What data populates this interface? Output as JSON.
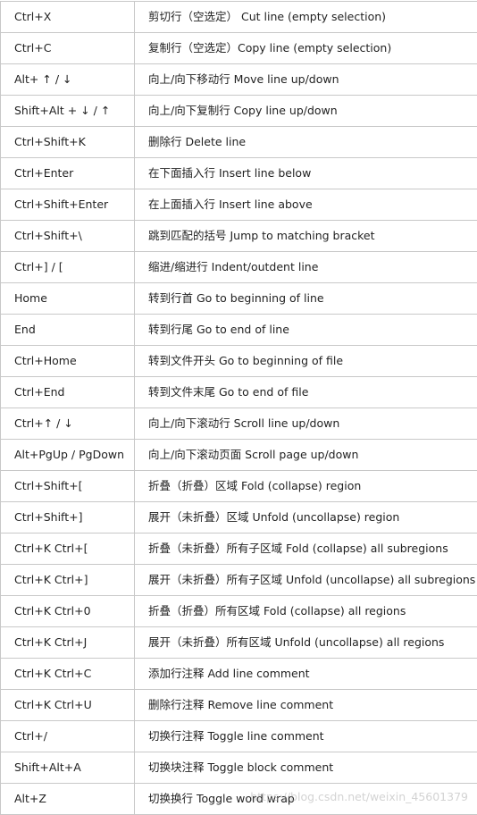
{
  "shortcuts": [
    {
      "key": "Ctrl+X",
      "description": "剪切行（空选定） Cut line (empty selection)"
    },
    {
      "key": "Ctrl+C",
      "description": "复制行（空选定）Copy line (empty selection)"
    },
    {
      "key": "Alt+ ↑ / ↓",
      "description": "向上/向下移动行 Move line up/down"
    },
    {
      "key": "Shift+Alt + ↓ / ↑",
      "description": "向上/向下复制行 Copy line up/down"
    },
    {
      "key": "Ctrl+Shift+K",
      "description": "删除行 Delete line"
    },
    {
      "key": "Ctrl+Enter",
      "description": "在下面插入行 Insert line below"
    },
    {
      "key": "Ctrl+Shift+Enter",
      "description": "在上面插入行 Insert line above"
    },
    {
      "key": "Ctrl+Shift+\\",
      "description": "跳到匹配的括号 Jump to matching bracket"
    },
    {
      "key": "Ctrl+] / [",
      "description": "缩进/缩进行 Indent/outdent line"
    },
    {
      "key": "Home",
      "description": "转到行首 Go to beginning of line"
    },
    {
      "key": "End",
      "description": "转到行尾 Go to end of line"
    },
    {
      "key": "Ctrl+Home",
      "description": "转到文件开头 Go to beginning of file"
    },
    {
      "key": "Ctrl+End",
      "description": "转到文件末尾 Go to end of file"
    },
    {
      "key": "Ctrl+↑ / ↓",
      "description": "向上/向下滚动行 Scroll line up/down"
    },
    {
      "key": "Alt+PgUp / PgDown",
      "description": "向上/向下滚动页面 Scroll page up/down"
    },
    {
      "key": "Ctrl+Shift+[",
      "description": "折叠（折叠）区域 Fold (collapse) region"
    },
    {
      "key": "Ctrl+Shift+]",
      "description": "展开（未折叠）区域 Unfold (uncollapse) region"
    },
    {
      "key": "Ctrl+K Ctrl+[",
      "description": "折叠（未折叠）所有子区域 Fold (collapse) all subregions"
    },
    {
      "key": "Ctrl+K Ctrl+]",
      "description": "展开（未折叠）所有子区域 Unfold (uncollapse) all subregions"
    },
    {
      "key": "Ctrl+K Ctrl+0",
      "description": "折叠（折叠）所有区域 Fold (collapse) all regions"
    },
    {
      "key": "Ctrl+K Ctrl+J",
      "description": "展开（未折叠）所有区域 Unfold (uncollapse) all regions"
    },
    {
      "key": "Ctrl+K Ctrl+C",
      "description": "添加行注释 Add line comment"
    },
    {
      "key": "Ctrl+K Ctrl+U",
      "description": "删除行注释 Remove line comment"
    },
    {
      "key": "Ctrl+/",
      "description": "切换行注释 Toggle line comment"
    },
    {
      "key": "Shift+Alt+A",
      "description": "切换块注释 Toggle block comment"
    },
    {
      "key": "Alt+Z",
      "description": "切换换行 Toggle word wrap"
    }
  ],
  "watermark": "https://blog.csdn.net/weixin_45601379",
  "colors": {
    "border": "#c8c8c8",
    "text": "#222222",
    "background": "#ffffff"
  }
}
